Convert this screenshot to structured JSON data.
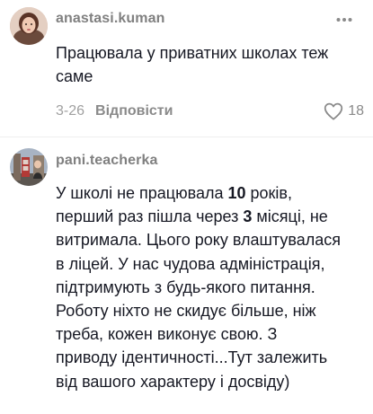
{
  "comments": [
    {
      "username": "anastasi.kuman",
      "text": "Працювала у приватних школах теж\nсаме",
      "date": "3-26",
      "reply_label": "Відповісти",
      "like_count": "18"
    },
    {
      "username": "pani.teacherka",
      "text_parts": [
        "У школі не працювала ",
        "10",
        " років,\nперший раз пішла через ",
        "3",
        " місяці, не\nвитримала. Цього року влаштувалася\nв ліцей. У нас чудова адміністрація,\nпідтримують з будь-якого питання.\nРоботу ніхто не скидує більше, ніж\nтреба, кожен виконує свою. З\nприводу ідентичності...Тут залежить\nвід вашого характеру і досвіду)"
      ]
    }
  ],
  "icons": {
    "more": "more-horizontal-icon",
    "like": "heart-outline-icon"
  },
  "colors": {
    "username": "#808080",
    "text": "#161823",
    "meta": "#a0a0a0"
  }
}
